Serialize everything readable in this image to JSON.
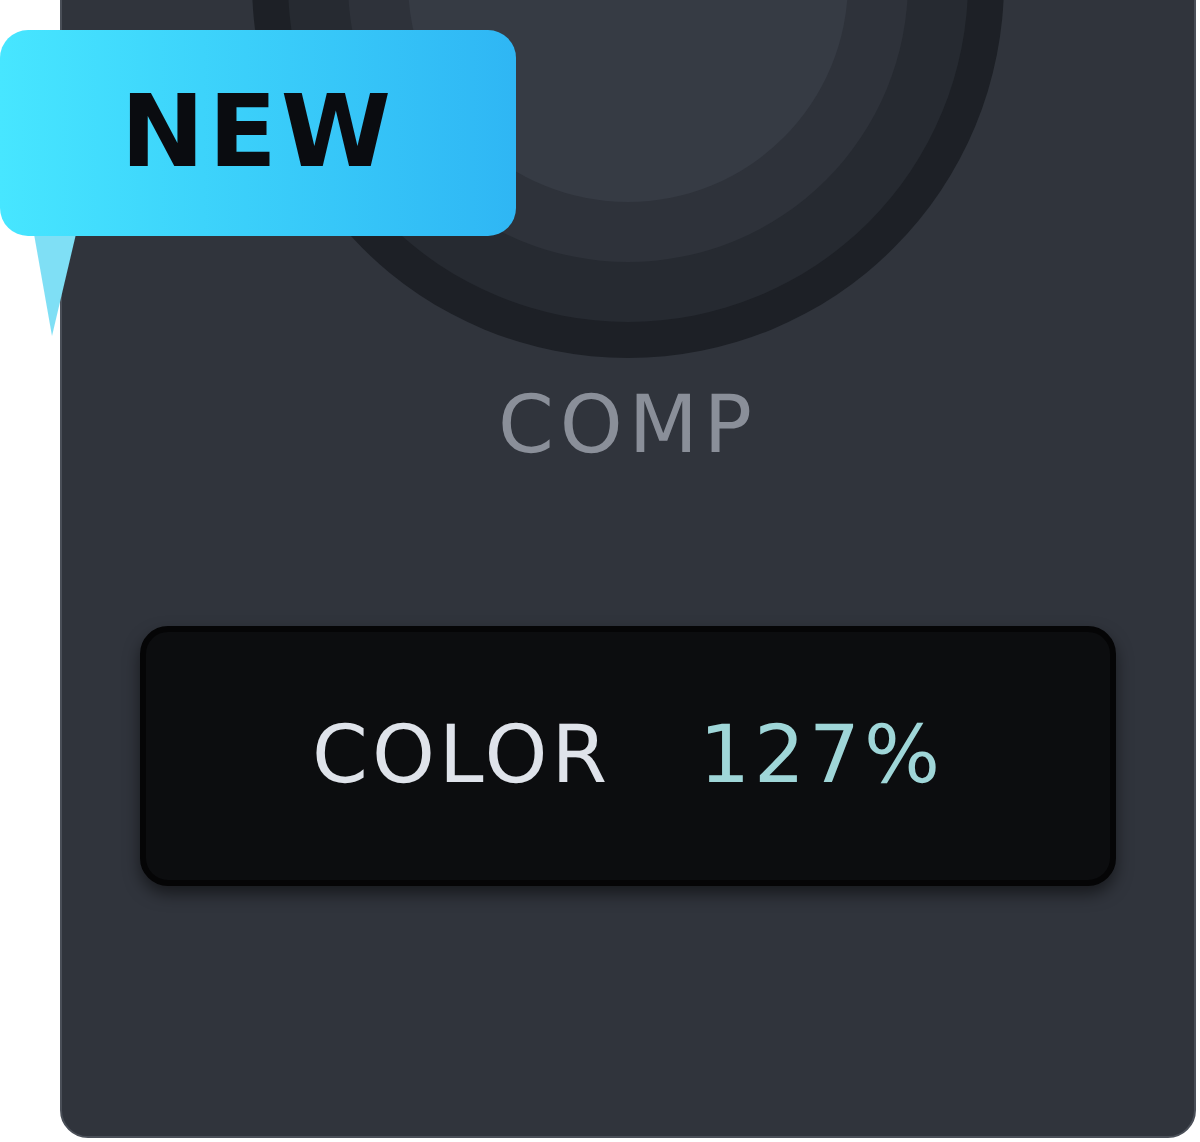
{
  "badge": {
    "text": "NEW"
  },
  "knob": {
    "label": "COMP"
  },
  "display": {
    "parameter": "COLOR",
    "value": "127%"
  }
}
